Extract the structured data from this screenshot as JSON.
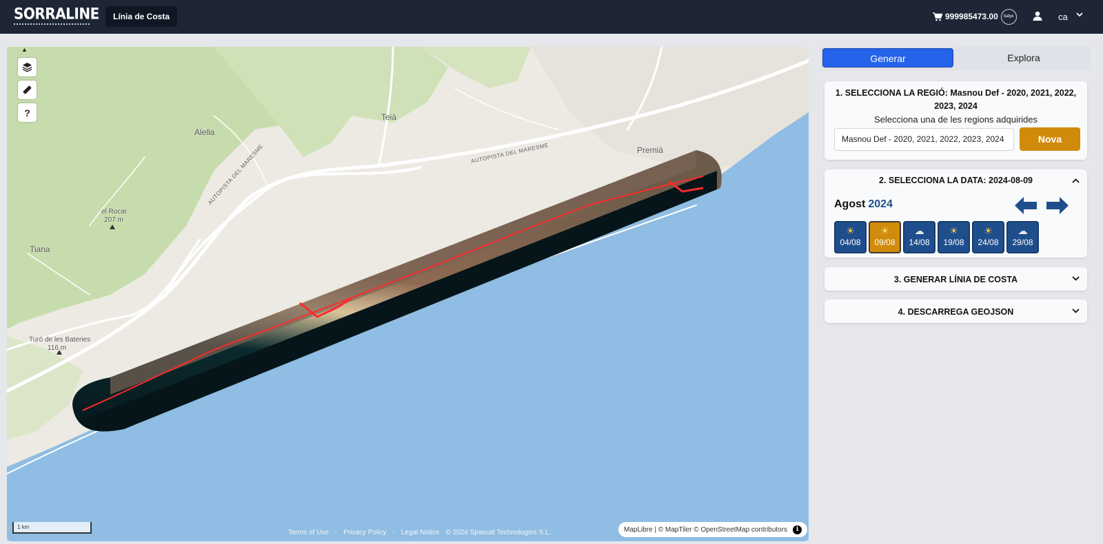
{
  "header": {
    "logo_text": "SORRALINE",
    "section": "Línia de Costa",
    "credits": "999985473.00",
    "coin_label": "balye",
    "language": "ca"
  },
  "map": {
    "labels": {
      "teia": "Teià",
      "alella": "Alella",
      "premia": "Premià",
      "el_rocar": "el Rocar",
      "el_rocar_alt": "207 m",
      "tiana": "Tiana",
      "turo": "Turó de les Bateries",
      "turo_alt": "116 m",
      "autopista1": "AUTOPISTA DEL MARESME",
      "autopista2": "AUTOPISTA DEL MARESME"
    },
    "controls": {
      "help": "?"
    },
    "scale": "1 km",
    "footer": {
      "terms": "Terms of Use",
      "sep1": "-",
      "privacy": "Privacy Policy",
      "sep2": "-",
      "legal": "Legal Notice",
      "copyright": "© 2024 Spascat Technologies S.L."
    },
    "attribution": "MapLibre | © MapTiler © OpenStreetMap contributors",
    "info": "i",
    "colors": {
      "sea": "#8fbde3",
      "land": "#eceae2",
      "forest": "#c4d9a9",
      "road": "#ffffff",
      "shoreline": "#ff2a2a"
    }
  },
  "sidebar": {
    "tabs": {
      "generate": "Generar",
      "explore": "Explora"
    },
    "step1": {
      "title": "1. SELECCIONA LA REGIÓ: Masnou Def - 2020, 2021, 2022, 2023, 2024",
      "subtitle": "Selecciona una de les regions adquirides",
      "select_value": "Masnou Def - 2020, 2021, 2022, 2023, 2024",
      "new_button": "Nova"
    },
    "step2": {
      "title": "2. SELECCIONA LA DATA: 2024-08-09",
      "month": "Agost",
      "year": "2024",
      "dates": [
        {
          "label": "04/08",
          "weather": "sun-icon",
          "glyph": "☀"
        },
        {
          "label": "09/08",
          "weather": "sun-icon",
          "glyph": "☀"
        },
        {
          "label": "14/08",
          "weather": "cloud-sun-icon",
          "glyph": "☁"
        },
        {
          "label": "19/08",
          "weather": "sun-icon",
          "glyph": "☀"
        },
        {
          "label": "24/08",
          "weather": "sun-icon",
          "glyph": "☀"
        },
        {
          "label": "29/08",
          "weather": "cloud-sun-icon",
          "glyph": "☁"
        }
      ],
      "selected": "09/08"
    },
    "step3": {
      "title": "3. GENERAR LÍNIA DE COSTA"
    },
    "step4": {
      "title": "4. DESCARREGA GEOJSON"
    },
    "colors": {
      "primary": "#2563eb",
      "accent": "#d18b0b",
      "date_tile": "#1f4e8c"
    }
  }
}
